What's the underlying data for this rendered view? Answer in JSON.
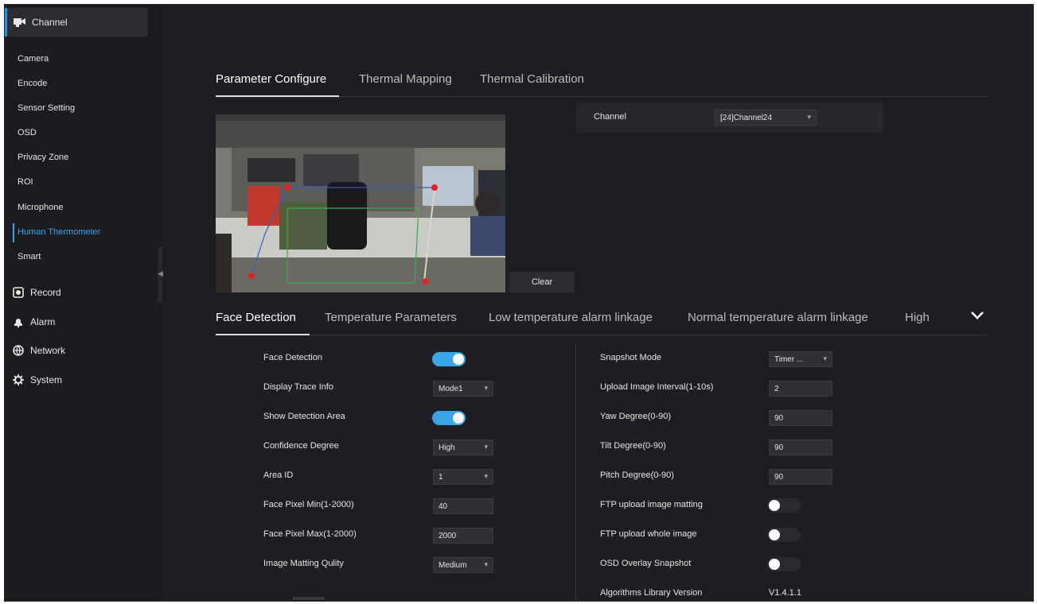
{
  "sidebar": {
    "top_label": "Channel",
    "sub_items": [
      "Camera",
      "Encode",
      "Sensor Setting",
      "OSD",
      "Privacy Zone",
      "ROI",
      "Microphone",
      "Human Thermometer",
      "Smart"
    ],
    "active_sub": "Human Thermometer",
    "main_items": [
      {
        "label": "Record",
        "icon": "record-icon"
      },
      {
        "label": "Alarm",
        "icon": "alarm-icon"
      },
      {
        "label": "Network",
        "icon": "network-icon"
      },
      {
        "label": "System",
        "icon": "system-icon"
      }
    ]
  },
  "top_tabs": [
    "Parameter Configure",
    "Thermal Mapping",
    "Thermal Calibration"
  ],
  "channel": {
    "label": "Channel",
    "value": "[24]Channel24"
  },
  "clear_label": "Clear",
  "sub_tabs": [
    "Face Detection",
    "Temperature Parameters",
    "Low temperature alarm linkage",
    "Normal temperature alarm linkage",
    "High"
  ],
  "left_fields": [
    {
      "label": "Face Detection",
      "type": "toggle",
      "value": "on"
    },
    {
      "label": "Display Trace Info",
      "type": "select",
      "value": "Mode1"
    },
    {
      "label": "Show Detection Area",
      "type": "toggle",
      "value": "on"
    },
    {
      "label": "Confidence Degree",
      "type": "select",
      "value": "High"
    },
    {
      "label": "Area ID",
      "type": "select",
      "value": "1"
    },
    {
      "label": "Face Pixel Min(1-2000)",
      "type": "input",
      "value": "40"
    },
    {
      "label": "Face Pixel Max(1-2000)",
      "type": "input",
      "value": "2000"
    },
    {
      "label": "Image Matting Qulity",
      "type": "select",
      "value": "Medium"
    }
  ],
  "right_fields": [
    {
      "label": "Snapshot Mode",
      "type": "select",
      "value": "Timer ..."
    },
    {
      "label": "Upload Image Interval(1-10s)",
      "type": "input",
      "value": "2"
    },
    {
      "label": "Yaw Degree(0-90)",
      "type": "input",
      "value": "90"
    },
    {
      "label": "Tilt Degree(0-90)",
      "type": "input",
      "value": "90"
    },
    {
      "label": "Pitch Degree(0-90)",
      "type": "input",
      "value": "90"
    },
    {
      "label": "FTP upload image matting",
      "type": "toggle",
      "value": "off"
    },
    {
      "label": "FTP upload whole image",
      "type": "toggle",
      "value": "off"
    },
    {
      "label": "OSD Overlay Snapshot",
      "type": "toggle",
      "value": "off"
    },
    {
      "label": "Algorithms Library Version",
      "type": "text",
      "value": "V1.4.1.1"
    }
  ],
  "colors": {
    "accent": "#3aa4e8",
    "background": "#1d1e21",
    "sidebar": "#1b1c1f"
  }
}
